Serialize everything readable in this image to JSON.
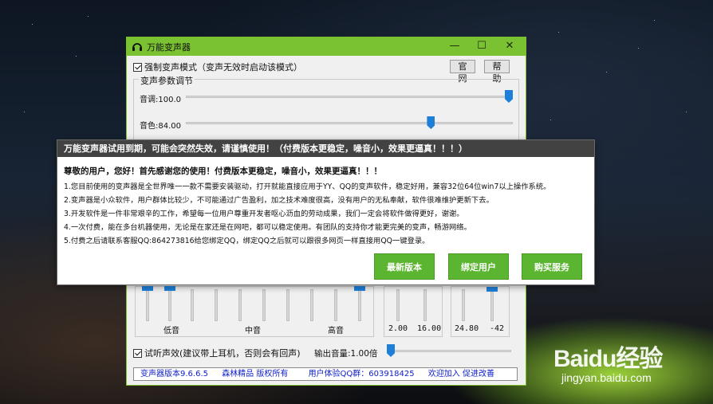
{
  "window": {
    "title": "万能变声器",
    "force_mode_label": "强制变声模式（变声无效时启动该模式）",
    "official_button": "官网",
    "help_button": "帮助",
    "group_title": "变声参数调节",
    "pitch_label": "音调:100.0",
    "pitch_level": 1.0,
    "timbre_label": "音色:84.00",
    "timbre_level": 0.84,
    "eq_labels": [
      "低音",
      "中音",
      "高音"
    ],
    "panel2_values": [
      "2.00",
      "16.00"
    ],
    "panel3_values": [
      "24.80",
      "-42"
    ],
    "listen_label": "试听声效(建议带上耳机，否则会有回声)",
    "output_volume_label": "输出音量:1.00倍",
    "output_volume_level": 0.0,
    "status": {
      "version": "变声器版本9.6.6.5",
      "author": "森林精品 版权所有",
      "qq_group": "用户体验QQ群：603918425",
      "join": "欢迎加入 促进改善"
    }
  },
  "dialog": {
    "header": "万能变声器试用到期，可能会突然失效，请谨慎使用！（付费版本更稳定，噪音小，效果更逼真！！！）",
    "greeting": "尊敬的用户，您好！首先感谢您的使用！付费版本更稳定，噪音小，效果更逼真！！！",
    "lines": [
      "1.您目前使用的变声器是全世界唯一一款不需要安装驱动，打开就能直接应用于YY、QQ的变声软件，稳定好用，兼容32位64位win7以上操作系统。",
      "2.变声器是小众软件，用户群体比较少，不可能通过广告盈利，加之技术难度很高，没有用户的无私奉献，软件很难维护更新下去。",
      "3.开发软件是一件非常艰辛的工作，希望每一位用户尊重开发者呕心沥血的劳动成果，我们一定会将软件做得更好，谢谢。",
      "4.一次付费，能在多台机器使用，无论是在家还是在网吧，都可以稳定使用。有团队的支持你才能更完美的变声，畅游网络。",
      "5.付费之后请联系客服QQ:864273816给您绑定QQ，绑定QQ之后就可以跟很多网页一样直接用QQ一键登录。"
    ],
    "buttons": [
      "最新版本",
      "绑定用户",
      "购买服务"
    ]
  },
  "watermark": {
    "logo": "Baidu经验",
    "url": "jingyan.baidu.com"
  },
  "colors": {
    "titlebar": "#7ac231",
    "dialog_header": "#424242",
    "green_button": "#5cb531",
    "slider_thumb": "#1e7fd8",
    "status_text": "#1020c8"
  }
}
